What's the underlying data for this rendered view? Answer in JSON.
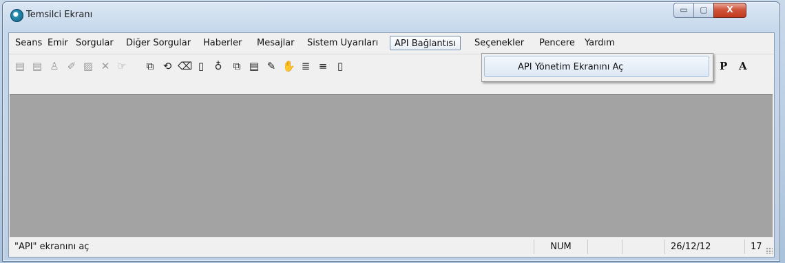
{
  "window": {
    "title": "Temsilci Ekranı",
    "app_icon": "app-logo-icon"
  },
  "caption_buttons": {
    "minimize": "▭",
    "maximize": "▢",
    "close": "X"
  },
  "menu": {
    "items": [
      {
        "label": "Seans"
      },
      {
        "label": "Emir"
      },
      {
        "label": "Sorgular"
      },
      {
        "label": "Diğer Sorgular"
      },
      {
        "label": "Haberler"
      },
      {
        "label": "Mesajlar"
      },
      {
        "label": "Sistem Uyarıları"
      },
      {
        "label": "API Bağlantısı",
        "active": true
      },
      {
        "label": "Seçenekler"
      },
      {
        "label": "Pencere"
      },
      {
        "label": "Yardım"
      }
    ],
    "dropdown": {
      "items": [
        {
          "label": "API Yönetim Ekranını Aç"
        }
      ]
    }
  },
  "toolbar": {
    "icons": [
      {
        "name": "new-document-icon",
        "glyph": "▤",
        "enabled": false
      },
      {
        "name": "copy-document-icon",
        "glyph": "▤",
        "enabled": false
      },
      {
        "name": "person-icon",
        "glyph": "♙",
        "enabled": false
      },
      {
        "name": "tools-icon",
        "glyph": "✐",
        "enabled": false
      },
      {
        "name": "properties-icon",
        "glyph": "▨",
        "enabled": false
      },
      {
        "name": "delete-icon",
        "glyph": "✕",
        "enabled": false
      },
      {
        "name": "pointer-hand-icon",
        "glyph": "☞",
        "enabled": false
      },
      {
        "name": "window-icon",
        "glyph": "⧉",
        "enabled": true
      },
      {
        "name": "cycle-icon",
        "glyph": "⟲",
        "enabled": true
      },
      {
        "name": "eraser-icon",
        "glyph": "⌫",
        "enabled": true
      },
      {
        "name": "book-icon",
        "glyph": "▯",
        "enabled": true
      },
      {
        "name": "bottle-icon",
        "glyph": "♁",
        "enabled": true
      },
      {
        "name": "copy-icon",
        "glyph": "⧉",
        "enabled": true
      },
      {
        "name": "clipboard-icon",
        "glyph": "▤",
        "enabled": true
      },
      {
        "name": "notes-icon",
        "glyph": "✎",
        "enabled": true
      },
      {
        "name": "hand-icon",
        "glyph": "✋",
        "enabled": true
      },
      {
        "name": "align-icon",
        "glyph": "≣",
        "enabled": true
      },
      {
        "name": "list-icon",
        "glyph": "≡",
        "enabled": true
      },
      {
        "name": "page-icon",
        "glyph": "▯",
        "enabled": true
      }
    ],
    "right_labels": [
      {
        "name": "p-text-tool",
        "text": "P"
      },
      {
        "name": "a-text-tool",
        "text": "A"
      }
    ]
  },
  "status": {
    "message": "\"API\" ekranını aç",
    "num": "NUM",
    "date": "26/12/12",
    "hour": "17"
  }
}
